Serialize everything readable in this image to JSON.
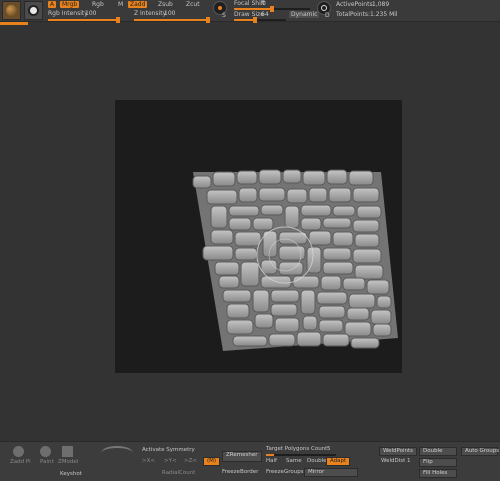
{
  "toolbar": {
    "a_label": "A",
    "mrgb_label": "Mrgb",
    "rgb_label": "Rgb",
    "m_label": "M",
    "zadd_label": "Zadd",
    "zsub_label": "Zsub",
    "zcut_label": "Zcut",
    "rgb_intensity_label": "Rgb Intensity",
    "rgb_intensity_value": "100",
    "z_intensity_label": "Z Intensity",
    "z_intensity_value": "100",
    "focal_shift_label": "Focal Shift",
    "focal_shift_value": "0",
    "draw_size_label": "Draw Size",
    "draw_size_value": "64",
    "dynamic_label": "Dynamic",
    "active_points_label": "ActivePoints:",
    "active_points_value": "1,089",
    "total_points_label": "TotalPoints:",
    "total_points_value": "1.235 Mil",
    "s_label": "S",
    "d_label": "D"
  },
  "bottom": {
    "zadd_pi_label": "Zadd Pi",
    "paint_label": "Paint",
    "zmodel_label": "ZModel",
    "keyshot_label": "Keyshot",
    "activate_symmetry_label": "Activate Symmetry",
    "x_label": ">X<",
    "y_label": ">Y<",
    "z_label": ">Z<",
    "m_label": "(M)",
    "radial_count_label": "RadialCount",
    "zremesher_label": "ZRemesher",
    "freeze_border_label": "FreezeBorder",
    "target_polygons_label": "Target Polygons Count",
    "target_polygons_value": "5",
    "half_label": "Half",
    "same_label": "Same",
    "double_label": "Double",
    "adapt_label": "Adapt",
    "freeze_groups_label": "FreezeGroups",
    "mirror_label": "Mirror",
    "weld_points_label": "WeldPoints",
    "weld_dist_label": "WeldDist",
    "weld_dist_value": "1",
    "double2_label": "Double",
    "flip_label": "Flip",
    "fill_holes_label": "Fill Holes",
    "auto_groups_label": "Auto Groups"
  },
  "colors": {
    "accent": "#e7821d",
    "background": "#333333",
    "canvas": "#1c1c1c",
    "stone": "#9a9a9a"
  }
}
